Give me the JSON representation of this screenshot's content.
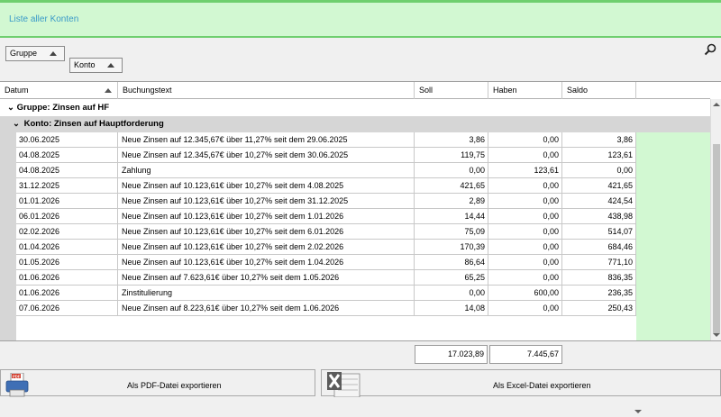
{
  "header": {
    "title": "Liste aller Konten"
  },
  "grouping": {
    "chips": [
      "Gruppe",
      "Konto"
    ],
    "search_icon": "search-icon"
  },
  "columns": [
    "Datum",
    "Buchungstext",
    "Soll",
    "Haben",
    "Saldo"
  ],
  "group": {
    "label": "Gruppe: Zinsen auf HF",
    "konto": "Konto: Zinsen auf Hauptforderung"
  },
  "rows": [
    {
      "datum": "30.06.2025",
      "text": "Neue Zinsen auf 12.345,67€ über 11,27% seit dem 29.06.2025",
      "soll": "3,86",
      "haben": "0,00",
      "saldo": "3,86"
    },
    {
      "datum": "04.08.2025",
      "text": "Neue Zinsen auf 12.345,67€ über 10,27% seit dem 30.06.2025",
      "soll": "119,75",
      "haben": "0,00",
      "saldo": "123,61"
    },
    {
      "datum": "04.08.2025",
      "text": "Zahlung",
      "soll": "0,00",
      "haben": "123,61",
      "saldo": "0,00"
    },
    {
      "datum": "31.12.2025",
      "text": "Neue Zinsen auf 10.123,61€ über 10,27% seit dem 4.08.2025",
      "soll": "421,65",
      "haben": "0,00",
      "saldo": "421,65"
    },
    {
      "datum": "01.01.2026",
      "text": "Neue Zinsen auf 10.123,61€ über 10,27% seit dem 31.12.2025",
      "soll": "2,89",
      "haben": "0,00",
      "saldo": "424,54"
    },
    {
      "datum": "06.01.2026",
      "text": "Neue Zinsen auf 10.123,61€ über 10,27% seit dem 1.01.2026",
      "soll": "14,44",
      "haben": "0,00",
      "saldo": "438,98"
    },
    {
      "datum": "02.02.2026",
      "text": "Neue Zinsen auf 10.123,61€ über 10,27% seit dem 6.01.2026",
      "soll": "75,09",
      "haben": "0,00",
      "saldo": "514,07"
    },
    {
      "datum": "01.04.2026",
      "text": "Neue Zinsen auf 10.123,61€ über 10,27% seit dem 2.02.2026",
      "soll": "170,39",
      "haben": "0,00",
      "saldo": "684,46"
    },
    {
      "datum": "01.05.2026",
      "text": "Neue Zinsen auf 10.123,61€ über 10,27% seit dem 1.04.2026",
      "soll": "86,64",
      "haben": "0,00",
      "saldo": "771,10"
    },
    {
      "datum": "01.06.2026",
      "text": "Neue Zinsen auf 7.623,61€ über 10,27% seit dem 1.05.2026",
      "soll": "65,25",
      "haben": "0,00",
      "saldo": "836,35"
    },
    {
      "datum": "01.06.2026",
      "text": "Zinstitulierung",
      "soll": "0,00",
      "haben": "600,00",
      "saldo": "236,35"
    },
    {
      "datum": "07.06.2026",
      "text": "Neue Zinsen auf 8.223,61€ über 10,27% seit dem 1.06.2026",
      "soll": "14,08",
      "haben": "0,00",
      "saldo": "250,43"
    }
  ],
  "totals": {
    "soll": "17.023,89",
    "haben": "7.445,67"
  },
  "footer": {
    "pdf_label": "Als PDF-Datei exportieren",
    "xls_label": "Als Excel-Datei exportieren"
  },
  "colors": {
    "accent_green": "#d2f8d2",
    "border_green": "#6fcf6f",
    "title_blue": "#3a9ac8"
  }
}
